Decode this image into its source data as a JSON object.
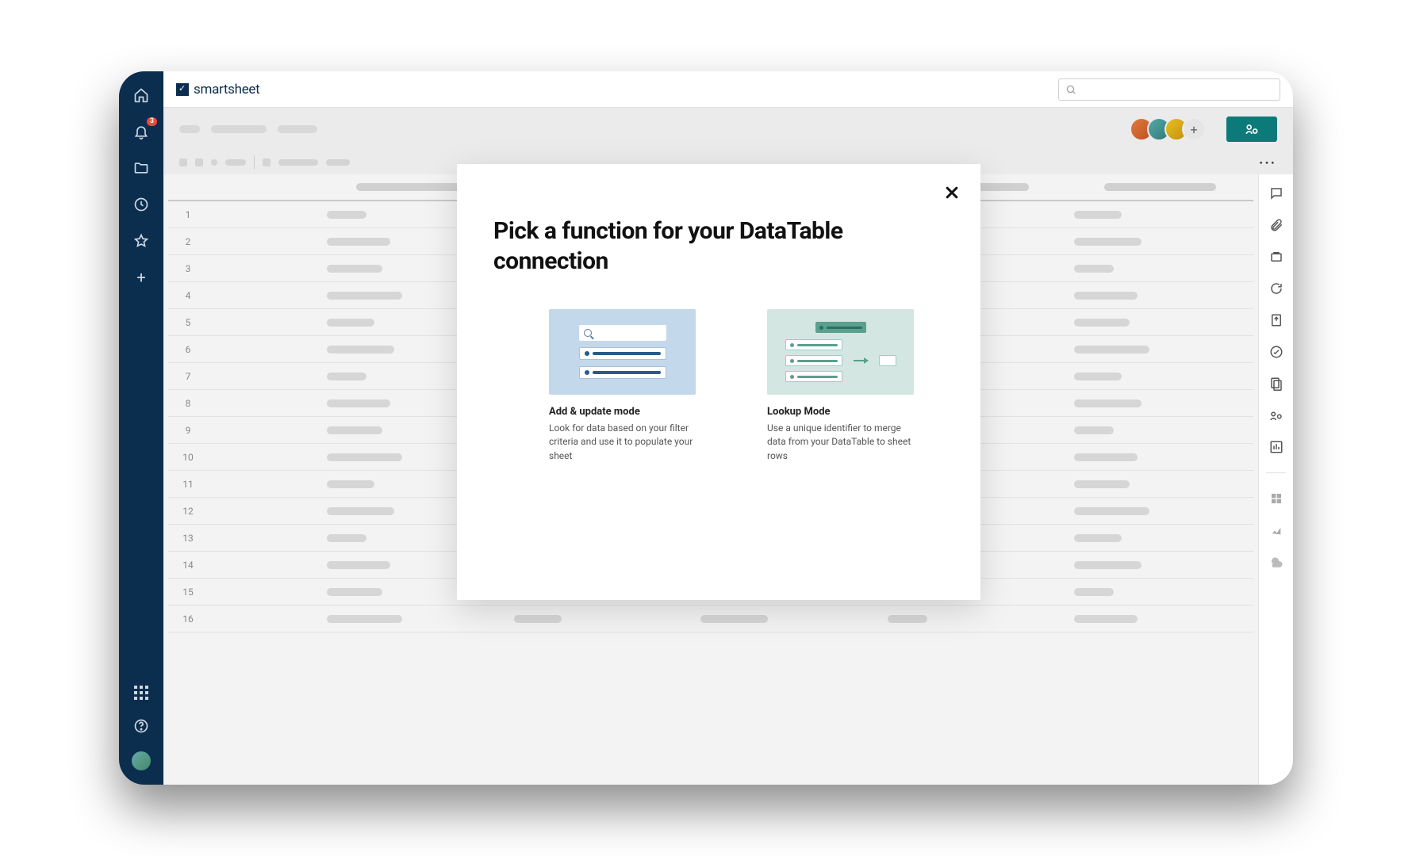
{
  "brand": "smartsheet",
  "notifications": {
    "count": "3"
  },
  "modal": {
    "title": "Pick a function for your DataTable connection",
    "options": [
      {
        "title": "Add & update mode",
        "desc": "Look for data based on your filter criteria and use it to populate your sheet"
      },
      {
        "title": "Lookup Mode",
        "desc": "Use a unique identifier to merge data from your DataTable to sheet rows"
      }
    ]
  },
  "rows": [
    "1",
    "2",
    "3",
    "4",
    "5",
    "6",
    "7",
    "8",
    "9",
    "10",
    "11",
    "12",
    "13",
    "14",
    "15",
    "16"
  ]
}
